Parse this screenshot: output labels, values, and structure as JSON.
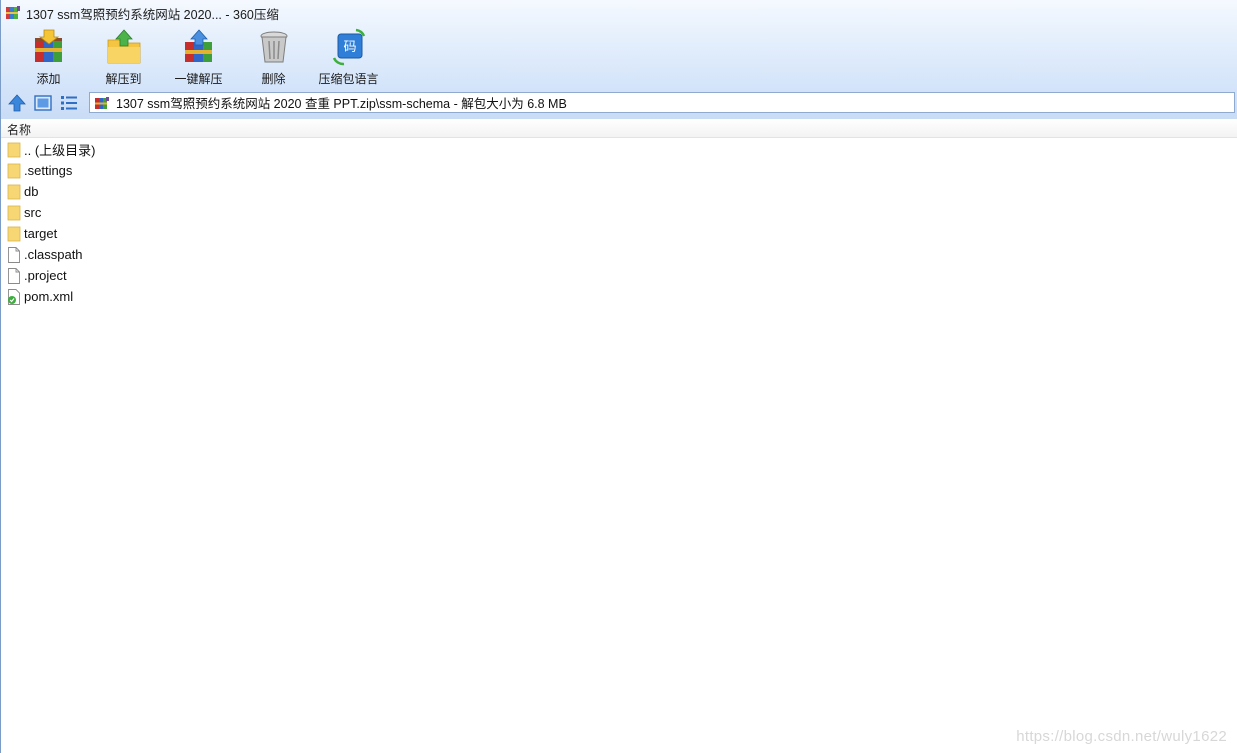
{
  "window": {
    "title": "1307 ssm驾照预约系统网站 2020... - 360压缩"
  },
  "toolbar": {
    "items": [
      {
        "label": "添加",
        "icon": "add-archive-icon"
      },
      {
        "label": "解压到",
        "icon": "extract-to-icon"
      },
      {
        "label": "一键解压",
        "icon": "one-click-extract-icon"
      },
      {
        "label": "删除",
        "icon": "delete-trash-icon"
      },
      {
        "label": "压缩包语言",
        "icon": "archive-language-icon"
      }
    ]
  },
  "address": {
    "path": "1307 ssm驾照预约系统网站 2020 查重 PPT.zip\\ssm-schema - 解包大小为 6.8 MB"
  },
  "list": {
    "column_name": "名称",
    "items": [
      {
        "name": ".. (上级目录)",
        "type": "folder"
      },
      {
        "name": ".settings",
        "type": "folder"
      },
      {
        "name": "db",
        "type": "folder"
      },
      {
        "name": "src",
        "type": "folder"
      },
      {
        "name": "target",
        "type": "folder"
      },
      {
        "name": ".classpath",
        "type": "file"
      },
      {
        "name": ".project",
        "type": "file"
      },
      {
        "name": "pom.xml",
        "type": "xml"
      }
    ]
  },
  "watermark": "https://blog.csdn.net/wuly1622",
  "colors": {
    "toolbar_top": "#f5f9ff",
    "toolbar_bottom": "#c9dcf6",
    "folder": "#f7d774",
    "accent": "#2f7fd8"
  }
}
